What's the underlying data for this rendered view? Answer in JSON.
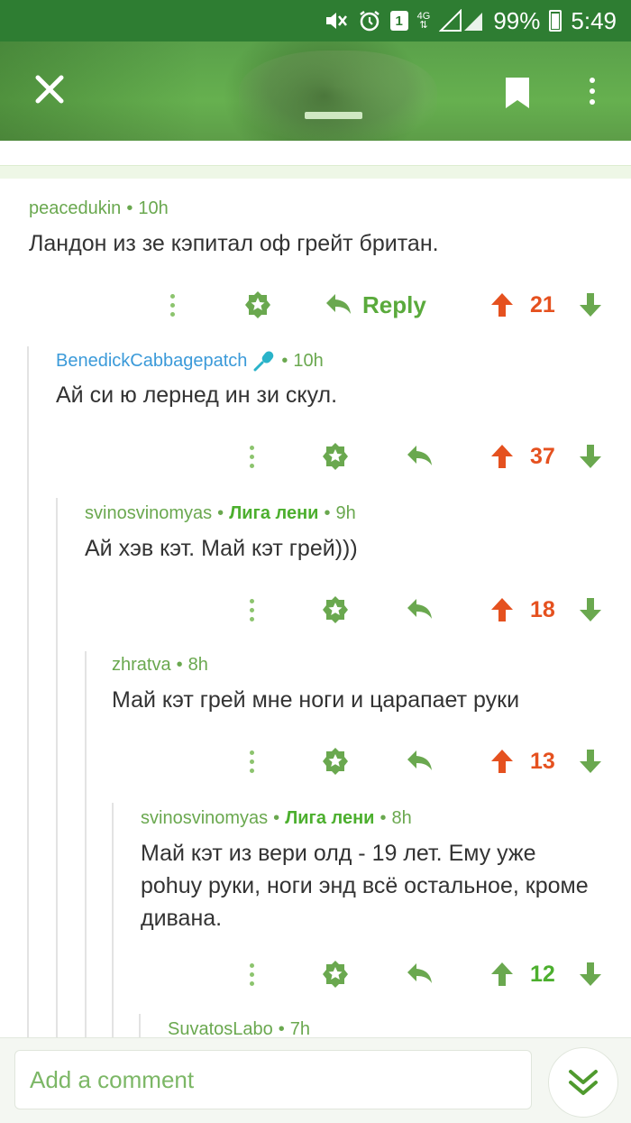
{
  "status_bar": {
    "sim": "1",
    "network": "4G",
    "battery": "99%",
    "time": "5:49"
  },
  "comments": [
    {
      "author": "peacedukin",
      "community": "",
      "time": "10h",
      "text": "Ландон из зе кэпитал оф грейт британ.",
      "votes": "21",
      "reply_label": "Reply"
    },
    {
      "author": "BenedickCabbagepatch",
      "community": "",
      "time": "10h",
      "text": "Ай си ю лернед ин зи скул.",
      "votes": "37"
    },
    {
      "author": "svinosvinomyas",
      "community": "Лига лени",
      "time": "9h",
      "text": "Ай хэв кэт. Май кэт грей)))",
      "votes": "18"
    },
    {
      "author": "zhratva",
      "community": "",
      "time": "8h",
      "text": "Май кэт грей мне ноги и царапает руки",
      "votes": "13"
    },
    {
      "author": "svinosvinomyas",
      "community": "Лига лени",
      "time": "8h",
      "text": "Май кэт из вери олд - 19 лет. Ему уже pohuy руки, ноги энд всё остальное, кроме дивана.",
      "votes": "12"
    },
    {
      "author": "SuvatosLabo",
      "community": "",
      "time": "7h",
      "text": ""
    }
  ],
  "bottom": {
    "comment_placeholder": "Add a comment"
  },
  "colors": {
    "brand_green": "#2e7d32",
    "upvoted_orange": "#e5511f",
    "action_green": "#5aaa3c"
  }
}
